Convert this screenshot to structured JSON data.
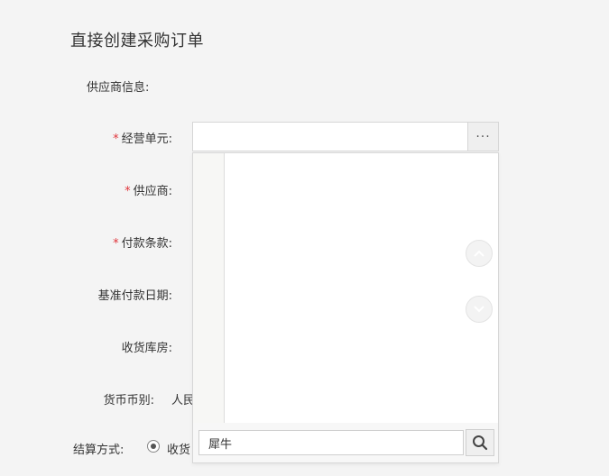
{
  "page": {
    "title": "直接创建采购订单"
  },
  "supplier_info": {
    "label": "供应商信息:"
  },
  "form": {
    "business_unit": {
      "required_mark": "*",
      "label": "经营单元:",
      "value": "",
      "picker_glyph": "···"
    },
    "supplier": {
      "required_mark": "*",
      "label": "供应商:"
    },
    "payment_terms": {
      "required_mark": "*",
      "label": "付款条款:"
    },
    "base_payment_date": {
      "label": "基准付款日期:"
    },
    "receiving_warehouse": {
      "label": "收货库房:"
    },
    "currency": {
      "label": "货币币别:",
      "value": "人民"
    },
    "settlement_method": {
      "label": "结算方式:",
      "option_label": "收货"
    }
  },
  "dropdown": {
    "search_value": "犀牛",
    "icons": {
      "scroll_up": "chevron-up-icon",
      "scroll_down": "chevron-down-icon",
      "search": "search-icon"
    }
  },
  "colors": {
    "required": "#e0353b",
    "background": "#f4f4f4"
  }
}
